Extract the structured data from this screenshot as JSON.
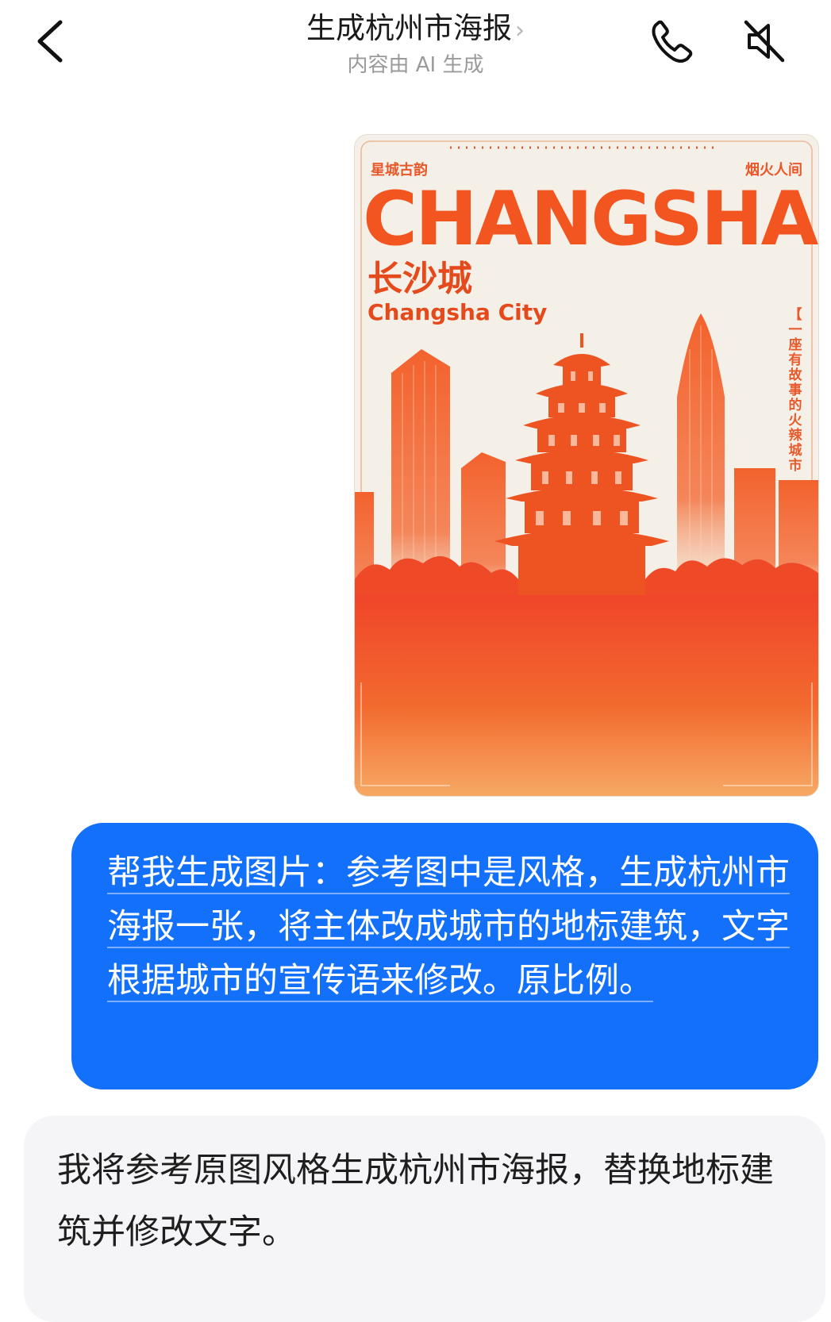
{
  "header": {
    "title": "生成杭州市海报",
    "title_chevron": "›",
    "subtitle": "内容由 AI 生成",
    "icons": [
      "back-arrow-icon",
      "phone-icon",
      "speaker-muted-icon"
    ]
  },
  "poster": {
    "top_left": "星城古韵",
    "top_right": "烟火人间",
    "main_title": "CHANGSHA",
    "cn_title": "长沙城",
    "en_title": "Changsha City",
    "vertical_text": "一座有故事的火辣城市",
    "bracket": "【",
    "colors": {
      "accent": "#f2551f",
      "background": "#f4efe7"
    }
  },
  "messages": [
    {
      "role": "user",
      "text": "帮我生成图片：参考图中是风格，生成杭州市海报一张，将主体改成城市的地标建筑，文字根据城市的宣传语来修改。原比例。"
    },
    {
      "role": "assistant",
      "text": "我将参考原图风格生成杭州市海报，替换地标建筑并修改文字。"
    }
  ],
  "colors": {
    "user_bubble": "#1270fb",
    "ai_bubble": "#f5f5f7"
  }
}
